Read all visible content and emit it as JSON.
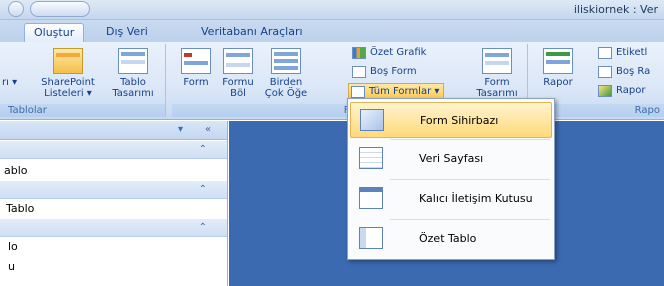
{
  "window": {
    "title": "iliskiornek : Ver"
  },
  "tabs": [
    {
      "label": "Oluştur",
      "active": true
    },
    {
      "label": "Dış Veri",
      "active": false
    },
    {
      "label": "Veritabanı Araçları",
      "active": false
    }
  ],
  "ribbon": {
    "group_tablolar": {
      "label": "Tablolar",
      "sharepoint_line1": "SharePoint",
      "sharepoint_line2": "Listeleri ▾",
      "tablo_line1": "Tablo",
      "tablo_line2": "Tasarımı",
      "partial_left": "rı ▾"
    },
    "group_formlar": {
      "label": "Fo",
      "form_line1": "Form",
      "formu_bol_line1": "Formu",
      "formu_bol_line2": "Böl",
      "birden_line1": "Birden",
      "birden_line2": "Çok Öğe",
      "ozet_grafik": "Özet Grafik",
      "bos_form": "Boş Form",
      "tum_formlar": "Tüm Formlar ▾",
      "form_tasarimi_line1": "Form",
      "form_tasarimi_line2": "Tasarımı"
    },
    "group_raporlar": {
      "label": "Rapo",
      "rapor_line1": "Rapor",
      "etiketler": "Etiketl",
      "bos_rapor": "Boş Ra",
      "rapor_sihirbazi": "Rapor"
    }
  },
  "nav_pane": {
    "items": [
      "ablo",
      "Tablo",
      "lo",
      "u"
    ]
  },
  "dropdown_menu": {
    "items": [
      {
        "label": "Form Sihirbazı",
        "hot": true
      },
      {
        "label": "Veri Sayfası",
        "hot": false
      },
      {
        "label": "Kalıcı İletişim Kutusu",
        "hot": false
      },
      {
        "label": "Özet Tablo",
        "hot": false
      }
    ]
  }
}
